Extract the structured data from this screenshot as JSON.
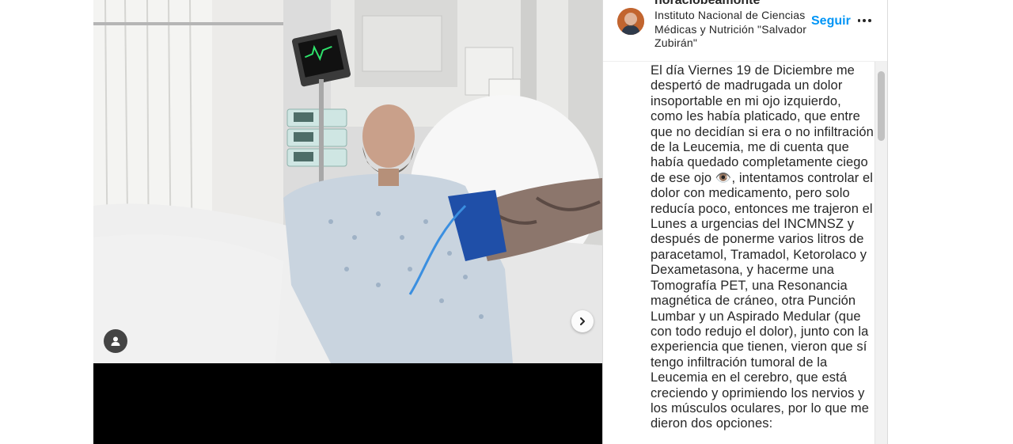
{
  "post": {
    "username": "horaciobeamonte",
    "location": "Instituto Nacional de Ciencias Médicas y Nutrición \"Salvador Zubirán\"",
    "follow_label": "Seguir",
    "caption": "El día Viernes 19 de Diciembre me despertó de madrugada un dolor insoportable en mi ojo izquierdo, como les había platicado, que entre que no decidían si era o no infiltración de la Leucemia, me di cuenta que había quedado completamente ciego de ese ojo 👁️, intentamos controlar el dolor con medicamento, pero solo reducía poco, entonces me trajeron el Lunes a urgencias del INCMNSZ y después de ponerme varios litros de paracetamol, Tramadol, Ketorolaco y Dexametasona, y hacerme una Tomografía PET, una Resonancia magnética de cráneo, otra Punción Lumbar y un Aspirado Medular (que con todo redujo el dolor), junto con la experiencia que tienen, vieron que sí tengo infiltración tumoral de la Leucemia en el cerebro, que está creciendo y oprimiendo los nervios y los músculos oculares, por lo que me dieron dos opciones:"
  },
  "icons": {
    "next": "chevron-right-icon",
    "tag": "user-tag-icon",
    "more": "more-options-icon"
  },
  "colors": {
    "follow": "#0095f6",
    "text": "#262626",
    "media_bg": "#000000"
  }
}
